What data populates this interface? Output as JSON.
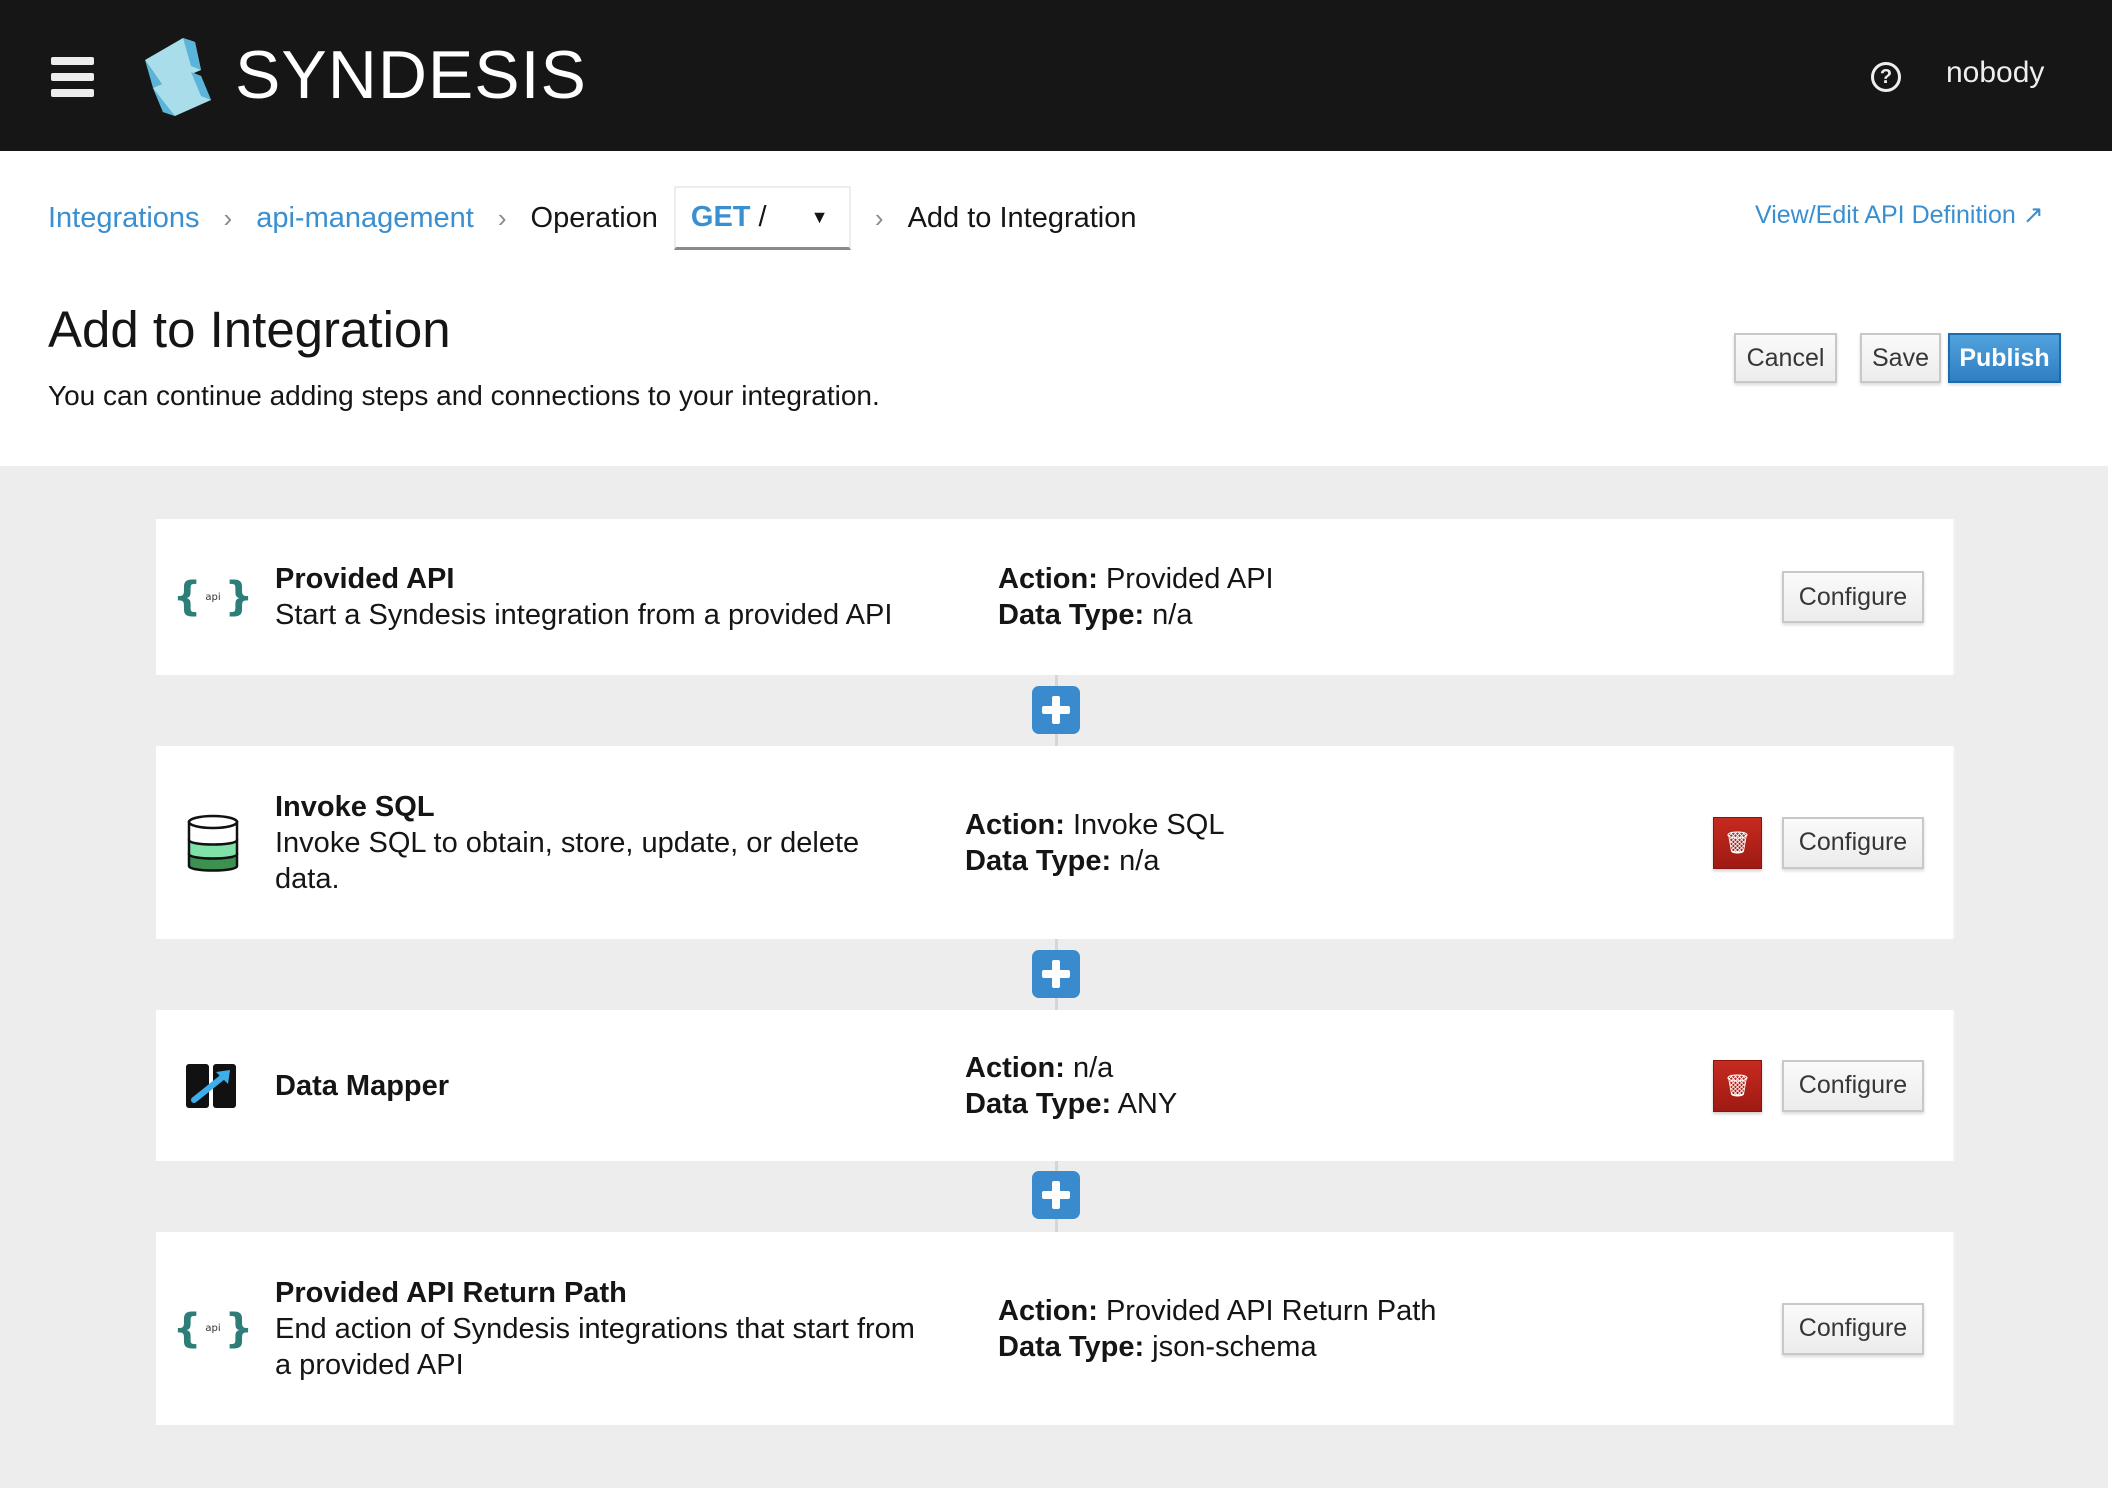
{
  "header": {
    "brand": "SYNDESIS",
    "user": "nobody",
    "help_icon": "?"
  },
  "breadcrumb": {
    "items": [
      "Integrations",
      "api-management"
    ],
    "operation_label": "Operation",
    "operation_method": "GET",
    "operation_path": "/",
    "current": "Add to Integration",
    "view_edit": "View/Edit API Definition"
  },
  "page": {
    "title": "Add to Integration",
    "subtitle": "You can continue adding steps and connections to your integration.",
    "cancel": "Cancel",
    "save": "Save",
    "publish": "Publish"
  },
  "labels": {
    "action": "Action:",
    "data_type": "Data Type:",
    "configure": "Configure",
    "api_icon_text": "api"
  },
  "steps": [
    {
      "title": "Provided API",
      "description": "Start a Syndesis integration from a provided API",
      "action": "Provided API",
      "data_type": "n/a"
    },
    {
      "title": "Invoke SQL",
      "description": "Invoke SQL to obtain, store, update, or delete data.",
      "action": "Invoke SQL",
      "data_type": "n/a"
    },
    {
      "title": "Data Mapper",
      "description": "",
      "action": "n/a",
      "data_type": "ANY"
    },
    {
      "title": "Provided API Return Path",
      "description": "End action of Syndesis integrations that start from a provided API",
      "action": "Provided API Return Path",
      "data_type": "json-schema"
    }
  ],
  "colors": {
    "accent": "#3a8bcd",
    "danger": "#b0231a",
    "topbar": "#161616"
  }
}
